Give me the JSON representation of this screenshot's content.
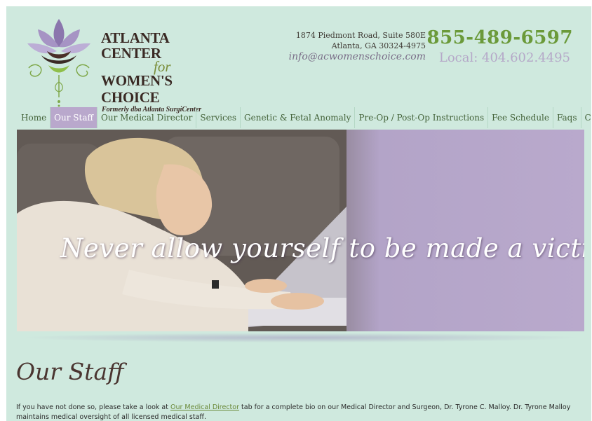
{
  "logo": {
    "line1": "ATLANTA CENTER",
    "line2": "for",
    "line3": "WOMEN'S CHOICE",
    "line4": "Formerly dba Atlanta SurgiCenter"
  },
  "contact": {
    "address_line1": "1874 Piedmont Road, Suite 580E",
    "address_line2": "Atlanta, GA 30324-4975",
    "email": "info@acwomenschoice.com",
    "phone_main": "855-489-6597",
    "phone_local": "Local: 404.602.4495"
  },
  "nav": {
    "items": [
      {
        "label": "Home"
      },
      {
        "label": "Our Staff"
      },
      {
        "label": "Our Medical Director"
      },
      {
        "label": "Services"
      },
      {
        "label": "Genetic & Fetal Anomaly"
      },
      {
        "label": "Pre-Op / Post-Op Instructions"
      },
      {
        "label": "Fee Schedule"
      },
      {
        "label": "Faqs"
      },
      {
        "label": "Contact Us"
      }
    ],
    "active": "Our Staff"
  },
  "hero": {
    "quote": "Never allow yourself to be made a victim."
  },
  "content": {
    "title": "Our Staff",
    "text_before_link": "If you have not done so, please take a look at ",
    "link_text": "Our Medical Director",
    "text_after_link": " tab for a complete bio on our Medical Director and Surgeon, Dr. Tyrone C. Malloy. Dr. Tyrone Malloy maintains medical oversight of all licensed medical staff."
  },
  "colors": {
    "page_bg": "#cfe9de",
    "nav_active": "#b9a8cc",
    "phone_green": "#6b9a3a",
    "local_lavender": "#b5a8c8"
  }
}
